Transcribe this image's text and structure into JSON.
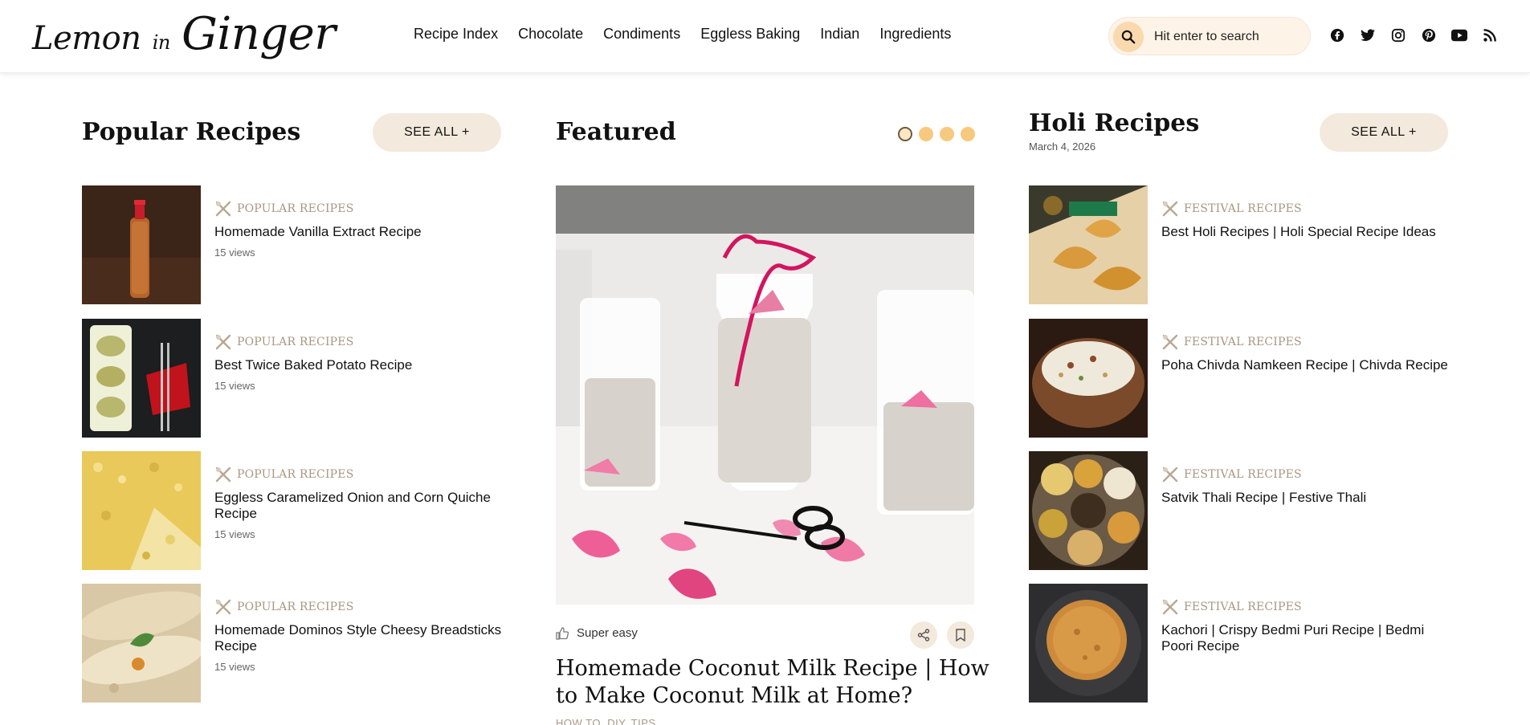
{
  "header": {
    "logo_text": "Lemon in Ginger",
    "logo_parts": {
      "a": "Lemon",
      "b": "in",
      "c": "Ginger"
    },
    "nav": [
      "Recipe Index",
      "Chocolate",
      "Condiments",
      "Eggless Baking",
      "Indian",
      "Ingredients"
    ],
    "search_placeholder": "Hit enter to search",
    "social_icons": [
      "facebook-icon",
      "twitter-icon",
      "instagram-icon",
      "pinterest-icon",
      "youtube-icon",
      "rss-icon"
    ]
  },
  "popular": {
    "title": "Popular Recipes",
    "see_all": "SEE ALL +",
    "items": [
      {
        "category": "POPULAR RECIPES",
        "title": "Homemade Vanilla Extract Recipe",
        "views": "15 views"
      },
      {
        "category": "POPULAR RECIPES",
        "title": "Best Twice Baked Potato Recipe",
        "views": "15 views"
      },
      {
        "category": "POPULAR RECIPES",
        "title": "Eggless Caramelized Onion and Corn Quiche Recipe",
        "views": "15 views"
      },
      {
        "category": "POPULAR RECIPES",
        "title": "Homemade Dominos Style Cheesy Breadsticks Recipe",
        "views": "15 views"
      }
    ]
  },
  "featured": {
    "title": "Featured",
    "slide_count": 4,
    "active_slide": 1,
    "difficulty": "Super easy",
    "post_title": "Homemade Coconut Milk Recipe | How to Make Coconut Milk at Home?",
    "category": "HOW TO, DIY, TIPS"
  },
  "holi": {
    "title": "Holi Recipes",
    "date": "March 4, 2026",
    "see_all": "SEE ALL +",
    "items": [
      {
        "category": "FESTIVAL RECIPES",
        "title": "Best Holi Recipes | Holi Special Recipe Ideas"
      },
      {
        "category": "FESTIVAL RECIPES",
        "title": "Poha Chivda Namkeen Recipe | Chivda Recipe"
      },
      {
        "category": "FESTIVAL RECIPES",
        "title": "Satvik Thali Recipe | Festive Thali"
      },
      {
        "category": "FESTIVAL RECIPES",
        "title": "Kachori | Crispy Bedmi Puri Recipe | Bedmi Poori Recipe"
      }
    ]
  },
  "colors": {
    "accent": "#f7c97e",
    "button_bg": "#f3e9dc",
    "category_text": "#a89783",
    "search_bg": "#fdf3e7"
  }
}
